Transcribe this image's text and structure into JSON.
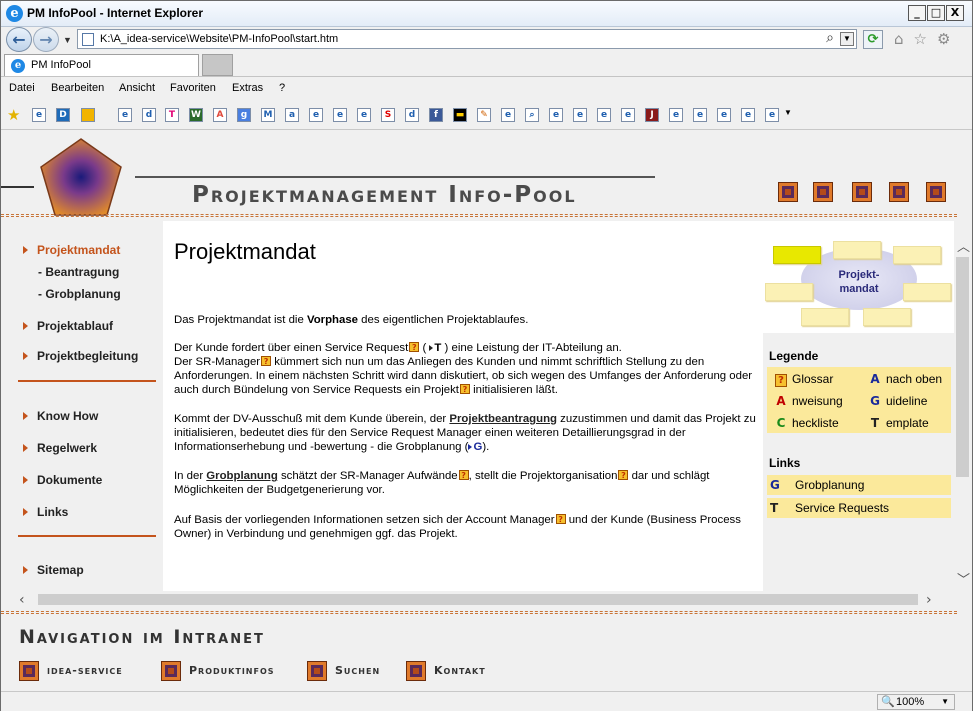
{
  "window": {
    "title": "PM InfoPool - Internet Explorer",
    "minimize": "_",
    "maximize": "□",
    "close": "X"
  },
  "address": {
    "url": "K:\\A_idea-service\\Website\\PM-InfoPool\\start.htm"
  },
  "tab": {
    "label": "PM InfoPool"
  },
  "menu": [
    "Datei",
    "Bearbeiten",
    "Ansicht",
    "Favoriten",
    "Extras",
    "?"
  ],
  "site": {
    "title": "Projektmanagement Info-Pool"
  },
  "nav": {
    "projektmandat": "Projektmandat",
    "beantragung": "- Beantragung",
    "grobplanung": "- Grobplanung",
    "projektablauf": "Projektablauf",
    "projektbegleitung": "Projektbegleitung",
    "knowhow": "Know How",
    "regelwerk": "Regelwerk",
    "dokumente": "Dokumente",
    "links": "Links",
    "sitemap": "Sitemap"
  },
  "main": {
    "heading": "Projektmandat",
    "p1_a": "Das Projektmandat ist die ",
    "p1_b": "Vorphase",
    "p1_c": " des eigentlichen Projektablaufes.",
    "p2_a": "Der Kunde fordert über einen Service Request",
    "p2_t": "T",
    "p2_b": " ) eine Leistung der IT-Abteilung an.",
    "p2_c": "Der SR-Manager",
    "p2_d": " kümmert sich nun um das Anliegen des Kunden und nimmt schriftlich Stellung zu den Anforderungen. In einem nächsten Schritt wird dann diskutiert, ob sich wegen des Umfanges der Anforderung oder auch durch Bündelung von Service Requests ein Projekt",
    "p2_e": " initialisieren läßt.",
    "p3_a": "Kommt der DV-Ausschuß mit dem Kunde überein, der ",
    "p3_link": "Projektbeantragung",
    "p3_b": " zuzustimmen und damit das Projekt zu initialisieren, bedeutet dies für den Service Request Manager einen weiteren Detaillierungsgrad in der Informationserhebung und -bewertung - die Grobplanung (",
    "p3_g": "G",
    "p3_c": ").",
    "p4_a": "In der ",
    "p4_link": "Grobplanung",
    "p4_b": " schätzt der SR-Manager Aufwände",
    "p4_c": ", stellt die Projektorganisation",
    "p4_d": " dar und schlägt Möglichkeiten der Budgetgenerierung vor.",
    "p5_a": "Auf Basis der vorliegenden Informationen setzen sich der Account Manager",
    "p5_b": " und der Kunde (Business Process Owner) in Verbindung und genehmigen ggf. das Projekt."
  },
  "right": {
    "cloud": "Projekt-\nmandat",
    "legend_title": "Legende",
    "legend": [
      {
        "icon": "?",
        "label": "Glossar"
      },
      {
        "icon": "A",
        "label": "nach oben"
      },
      {
        "icon": "A",
        "label": "nweisung"
      },
      {
        "icon": "G",
        "label": "uideline"
      },
      {
        "icon": "C",
        "label": "heckliste"
      },
      {
        "icon": "T",
        "label": "emplate"
      }
    ],
    "links_title": "Links",
    "links": [
      {
        "icon": "G",
        "label": "Grobplanung"
      },
      {
        "icon": "T",
        "label": "Service Requests"
      }
    ]
  },
  "footer": {
    "title": "Navigation im Intranet",
    "items": [
      "idea-service",
      "Produktinfos",
      "Suchen",
      "Kontakt"
    ]
  },
  "status": {
    "zoom": "100%"
  },
  "colors": {
    "accent": "#c4541c",
    "legend_bg": "#fbe99b",
    "content_bg": "#ffffff"
  }
}
